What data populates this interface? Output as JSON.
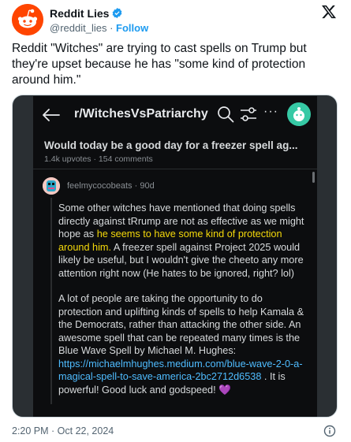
{
  "account": {
    "name": "Reddit Lies",
    "handle": "@reddit_lies",
    "dot": "·",
    "follow_label": "Follow",
    "verified": true
  },
  "tweet": {
    "text": "Reddit \"Witches\" are trying to cast spells on Trump but they're upset because he has \"some kind of protection around him.\"",
    "timestamp": "2:20 PM · Oct 22, 2024"
  },
  "screenshot": {
    "subreddit": "r/WitchesVsPatriarchy",
    "post_title": "Would today be a good day for a freezer spell ag...",
    "upvotes": "1.4k upvotes",
    "comments": "154 comments",
    "meta_sep": "·",
    "more_label": "···",
    "comment": {
      "user": "feelmycocobeats",
      "age": "90d",
      "p1_a": "Some other witches have mentioned that doing spells directly against tRrump are not as effective as we might hope as ",
      "p1_highlight": "he seems to have some kind of protection around him.",
      "p1_b": " A freezer spell against Project 2025 would likely be useful, but I wouldn't give the cheeto any more attention right now (He hates to be ignored, right? lol)",
      "p2_a": "A lot of people are taking the opportunity to do protection and uplifting kinds of spells to help Kamala & the Democrats, rather than attacking the other side. An awesome spell that can be repeated many times is the Blue Wave Spell by Michael M. Hughes: ",
      "p2_link": "https://michaelmhughes.medium.com/blue-wave-2-0-a-magical-spell-to-save-america-2bc2712d6538",
      "p2_b": " . It is powerful! Good luck and godspeed! ",
      "p2_emoji": "💜"
    }
  },
  "colors": {
    "brand": "#ff4500",
    "verified": "#1d9bf0",
    "link": "#4fbcff",
    "highlight": "#f5d90a"
  },
  "icons": [
    "reddit-logo-icon",
    "verified-badge-icon",
    "x-logo-icon",
    "back-arrow-icon",
    "search-icon",
    "filter-icon",
    "more-icon",
    "info-icon"
  ]
}
